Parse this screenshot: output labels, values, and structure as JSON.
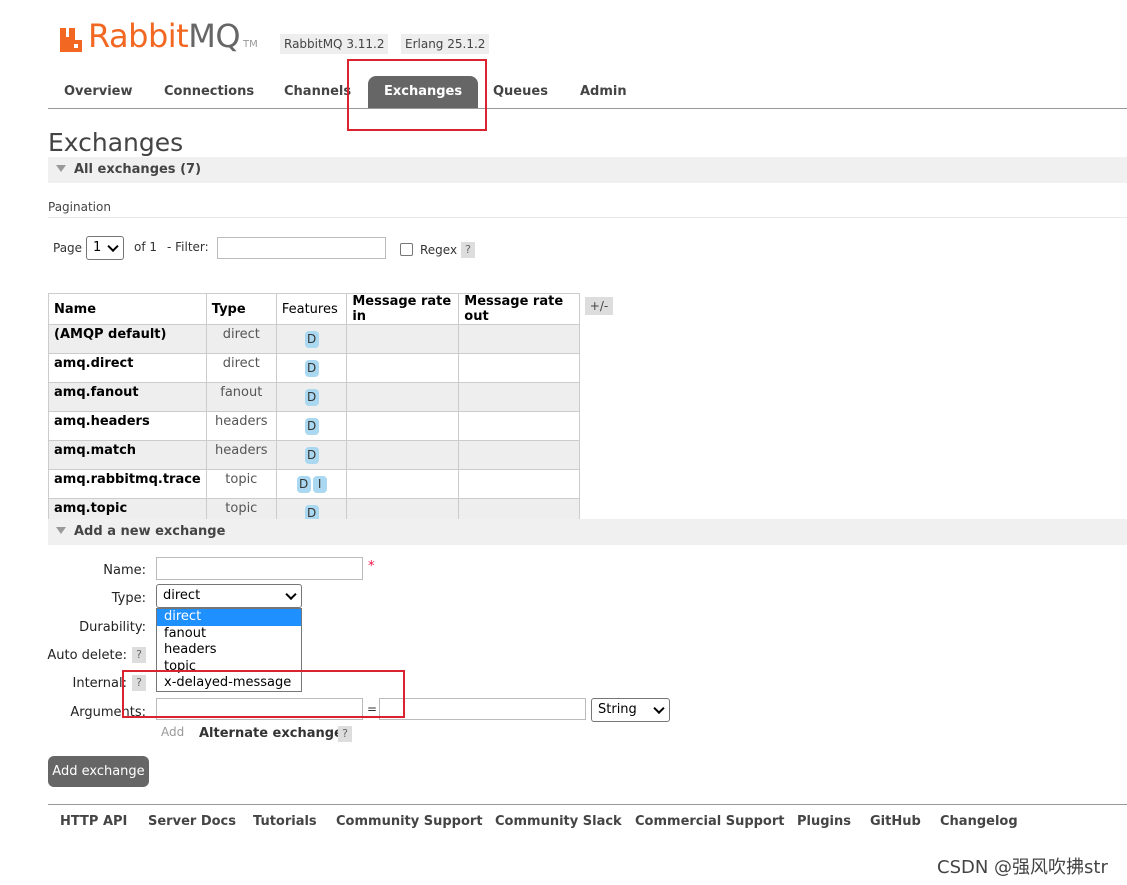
{
  "header": {
    "logo_rabbit": "Rabbit",
    "logo_mq": "MQ",
    "logo_tm": "TM",
    "rabbitmq_version": "RabbitMQ 3.11.2",
    "erlang_version": "Erlang 25.1.2"
  },
  "tabs": [
    "Overview",
    "Connections",
    "Channels",
    "Exchanges",
    "Queues",
    "Admin"
  ],
  "active_tab": "Exchanges",
  "page_title": "Exchanges",
  "all_exchanges": "All exchanges (7)",
  "pagination": {
    "label": "Pagination",
    "page_label": "Page",
    "page_value": "1",
    "of_label": "of 1",
    "filter_label": "- Filter:",
    "filter_value": "",
    "regex_label": "Regex",
    "help": "?"
  },
  "table": {
    "columns": [
      "Name",
      "Type",
      "Features",
      "Message rate in",
      "Message rate out"
    ],
    "plus_minus": "+/-",
    "rows": [
      {
        "name": "(AMQP default)",
        "type": "direct",
        "features": [
          "D"
        ]
      },
      {
        "name": "amq.direct",
        "type": "direct",
        "features": [
          "D"
        ]
      },
      {
        "name": "amq.fanout",
        "type": "fanout",
        "features": [
          "D"
        ]
      },
      {
        "name": "amq.headers",
        "type": "headers",
        "features": [
          "D"
        ]
      },
      {
        "name": "amq.match",
        "type": "headers",
        "features": [
          "D"
        ]
      },
      {
        "name": "amq.rabbitmq.trace",
        "type": "topic",
        "features": [
          "D",
          "I"
        ]
      },
      {
        "name": "amq.topic",
        "type": "topic",
        "features": [
          "D"
        ]
      }
    ]
  },
  "add_section": {
    "title": "Add a new exchange",
    "name_label": "Name:",
    "required_mark": "*",
    "type_label": "Type:",
    "type_value": "direct",
    "type_options": [
      "direct",
      "fanout",
      "headers",
      "topic",
      "x-delayed-message"
    ],
    "durability_label": "Durability:",
    "auto_delete_label": "Auto delete:",
    "internal_label": "Internal:",
    "arguments_label": "Arguments:",
    "equals": "=",
    "arg_type_value": "String",
    "add_link": "Add",
    "alternate_exchange": "Alternate exchange",
    "help": "?",
    "submit": "Add exchange"
  },
  "footer": [
    "HTTP API",
    "Server Docs",
    "Tutorials",
    "Community Support",
    "Community Slack",
    "Commercial Support",
    "Plugins",
    "GitHub",
    "Changelog"
  ],
  "watermark": "CSDN @强风吹拂str"
}
